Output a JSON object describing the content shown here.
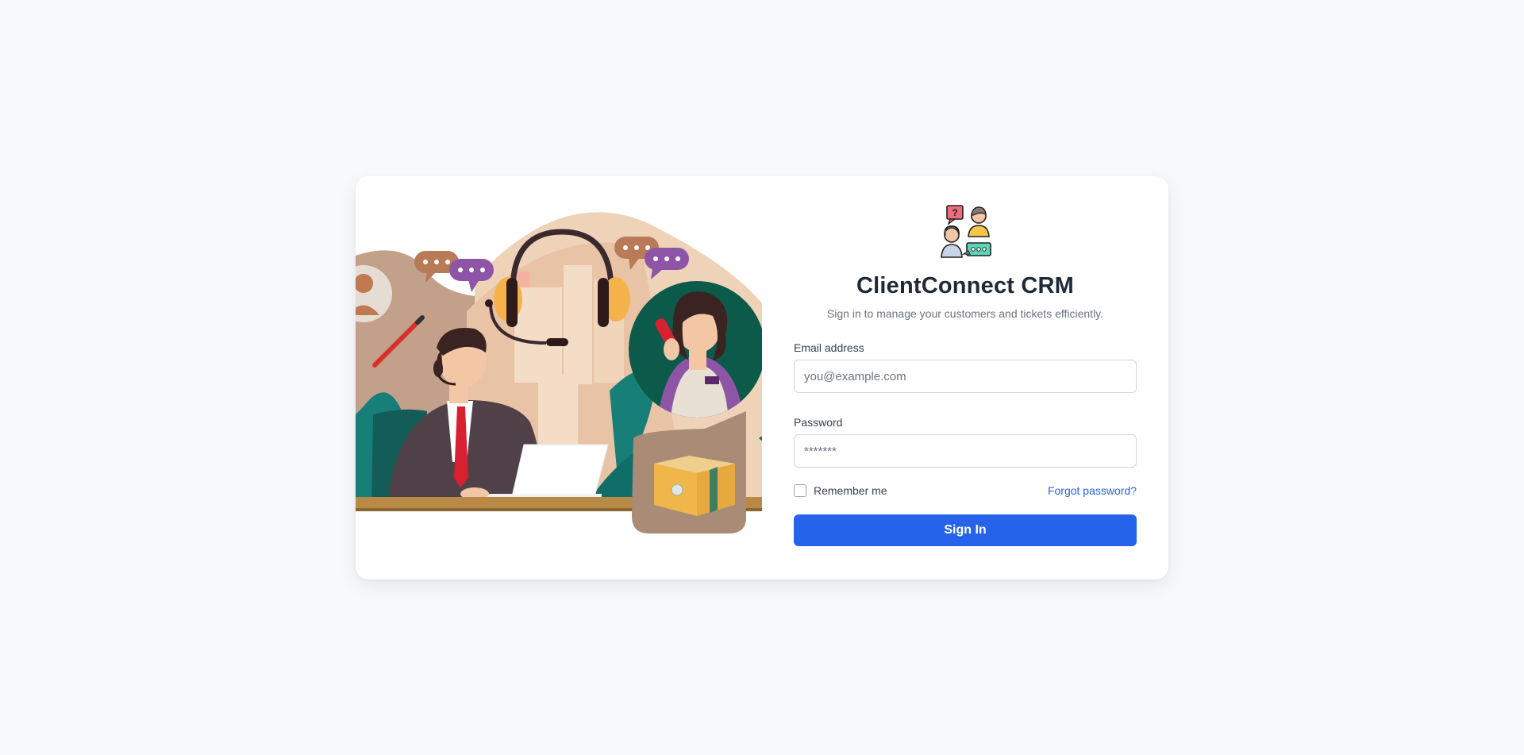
{
  "app": {
    "title": "ClientConnect CRM",
    "subtitle": "Sign in to manage your customers and tickets efficiently."
  },
  "illustration": {
    "icon": "customer-support-illustration"
  },
  "logo": {
    "icon": "support-team-logo-icon"
  },
  "form": {
    "email_label": "Email address",
    "email_placeholder": "you@example.com",
    "email_value": "",
    "password_label": "Password",
    "password_placeholder": "*******",
    "password_value": "",
    "remember_label": "Remember me",
    "remember_checked": false,
    "forgot_label": "Forgot password?",
    "submit_label": "Sign In"
  },
  "colors": {
    "accent": "#2563eb",
    "background": "#f8f9fb",
    "card": "#ffffff",
    "title": "#1f2937"
  }
}
